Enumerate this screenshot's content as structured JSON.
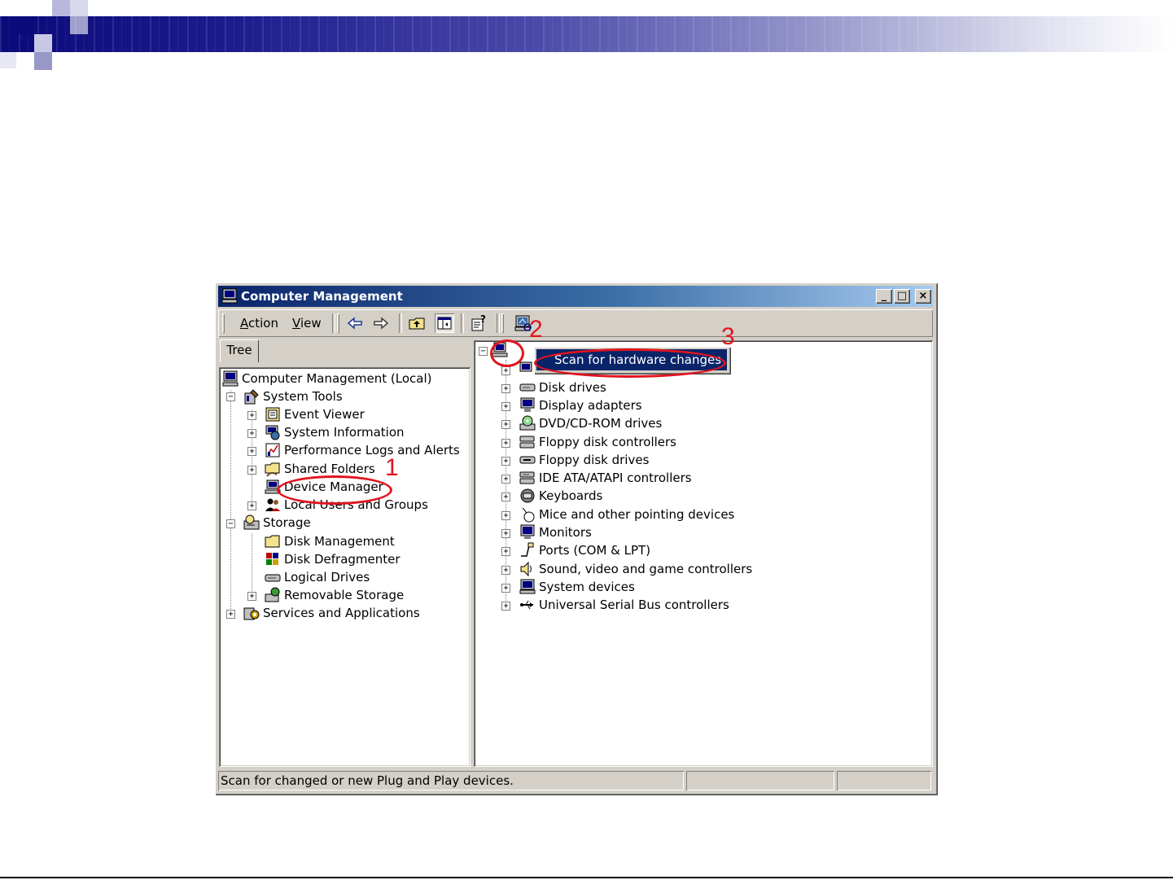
{
  "window": {
    "title": "Computer Management",
    "minimize_label": "_",
    "maximize_label": "□",
    "close_label": "×"
  },
  "toolbar": {
    "menus": [
      {
        "key": "A",
        "rest": "ction"
      },
      {
        "key": "V",
        "rest": "iew"
      }
    ],
    "icons": [
      "back-arrow-icon",
      "forward-arrow-icon",
      "up-one-level-icon",
      "show-hide-console-tree-icon",
      "properties-help-icon",
      "scan-hardware-icon"
    ]
  },
  "tab": {
    "label": "Tree"
  },
  "tree": [
    {
      "label": "Computer Management (Local)",
      "icon": "computer-icon"
    },
    {
      "label": "System Tools",
      "icon": "system-tools-icon"
    },
    {
      "label": "Event Viewer",
      "icon": "event-viewer-icon"
    },
    {
      "label": "System Information",
      "icon": "system-information-icon"
    },
    {
      "label": "Performance Logs and Alerts",
      "icon": "performance-logs-icon"
    },
    {
      "label": "Shared Folders",
      "icon": "shared-folder-icon"
    },
    {
      "label": "Device Manager",
      "icon": "device-manager-icon"
    },
    {
      "label": "Local Users and Groups",
      "icon": "users-groups-icon"
    },
    {
      "label": "Storage",
      "icon": "storage-icon"
    },
    {
      "label": "Disk Management",
      "icon": "disk-management-icon"
    },
    {
      "label": "Disk Defragmenter",
      "icon": "disk-defragmenter-icon"
    },
    {
      "label": "Logical Drives",
      "icon": "logical-drives-icon"
    },
    {
      "label": "Removable Storage",
      "icon": "removable-storage-icon"
    },
    {
      "label": "Services and Applications",
      "icon": "services-applications-icon"
    }
  ],
  "devices": [
    {
      "label": "Disk drives",
      "icon": "disk-drive-icon"
    },
    {
      "label": "Display adapters",
      "icon": "display-adapter-icon"
    },
    {
      "label": "DVD/CD-ROM drives",
      "icon": "dvd-drive-icon"
    },
    {
      "label": "Floppy disk controllers",
      "icon": "floppy-controller-icon"
    },
    {
      "label": "Floppy disk drives",
      "icon": "floppy-drive-icon"
    },
    {
      "label": "IDE ATA/ATAPI controllers",
      "icon": "ide-controller-icon"
    },
    {
      "label": "Keyboards",
      "icon": "keyboard-icon"
    },
    {
      "label": "Mice and other pointing devices",
      "icon": "mouse-icon"
    },
    {
      "label": "Monitors",
      "icon": "monitor-icon"
    },
    {
      "label": "Ports (COM & LPT)",
      "icon": "port-icon"
    },
    {
      "label": "Sound, video and game controllers",
      "icon": "sound-icon"
    },
    {
      "label": "System devices",
      "icon": "system-devices-icon"
    },
    {
      "label": "Universal Serial Bus controllers",
      "icon": "usb-icon"
    }
  ],
  "context_menu": {
    "item": "Scan for hardware changes"
  },
  "status": {
    "text": "Scan for changed or new Plug and Play devices."
  },
  "annotations": [
    "1",
    "2",
    "3"
  ]
}
